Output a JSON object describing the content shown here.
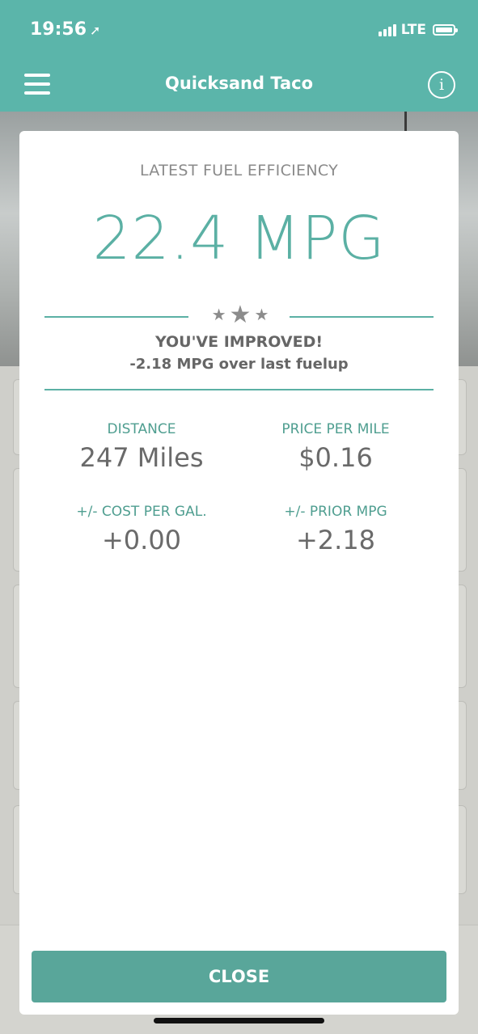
{
  "status_bar": {
    "time": "19:56",
    "network": "LTE"
  },
  "nav": {
    "title": "Quicksand Taco",
    "menu_icon": "hamburger-menu-icon",
    "info_icon": "info-icon",
    "info_glyph": "i"
  },
  "modal": {
    "heading": "LATEST FUEL EFFICIENCY",
    "mpg": "22.4 MPG",
    "stars_icon": "three-stars-icon",
    "improved_title": "YOU'VE IMPROVED!",
    "improved_sub": "-2.18 MPG over last fuelup",
    "stats": [
      {
        "label": "DISTANCE",
        "value": "247 Miles"
      },
      {
        "label": "PRICE PER MILE",
        "value": "$0.16"
      },
      {
        "label": "+/- COST PER GAL.",
        "value": "+0.00"
      },
      {
        "label": "+/- PRIOR MPG",
        "value": "+2.18"
      }
    ],
    "close_label": "CLOSE"
  },
  "colors": {
    "accent": "#5bb5aa",
    "button": "#59a69a",
    "stat_label": "#4f9e90"
  }
}
